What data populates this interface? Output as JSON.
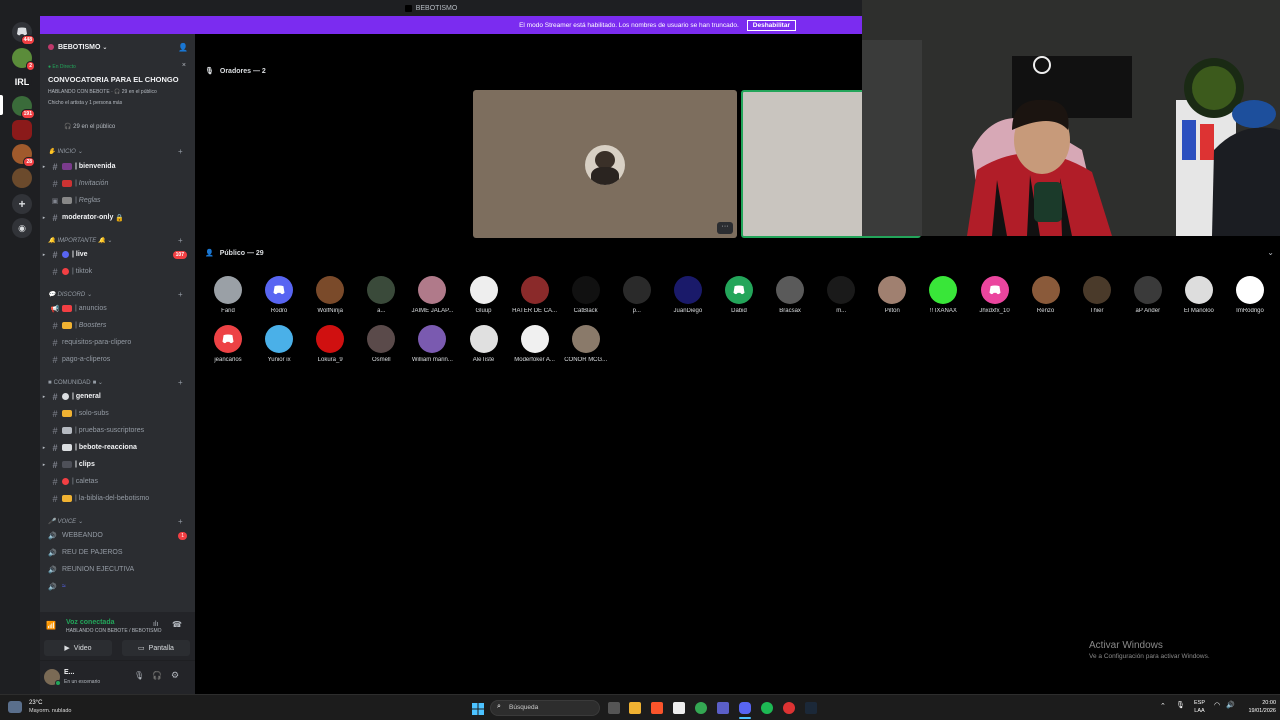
{
  "window": {
    "title": "BEBOTISMO"
  },
  "banner": {
    "message": "El modo Streamer está habilitado. Los nombres de usuario se han truncado.",
    "button": "Deshabilitar",
    "color": "#7b2cf0"
  },
  "rail": {
    "badges": {
      "home": "448",
      "s1": "2",
      "s2": "191",
      "s3": "28"
    },
    "irl_label": "IRL"
  },
  "server": {
    "name": "BEBOTISMO"
  },
  "live": {
    "status": "En Directo",
    "title": "CONVOCATORIA PARA EL CHONGO",
    "sub": "HABLANDO CON BEBOTE · 🎧 29 en el público",
    "sub2": "Chicho el artista y 1 persona más",
    "audience": "29 en el público"
  },
  "categories": {
    "inicio": "INICIO",
    "importante": "IMPORTANTE",
    "discord": "DISCORD",
    "comunidad": "COMUNIDAD",
    "voice": "VOICE"
  },
  "channels": {
    "bienvenida": "| bienvenida",
    "invitacion": "| Invitación",
    "reglas": "| Reglas",
    "moderator": "moderator-only",
    "live": "| live",
    "live_count": "107",
    "tiktok": "| tiktok",
    "anuncios": "| anuncios",
    "boosters": "| Boosters",
    "requisitos": "requisitos-para-clipero",
    "pago": "pago-a-cliperos",
    "general": "| general",
    "solosubs": "| solo-subs",
    "pruebas": "| pruebas-suscriptores",
    "bebote": "| bebote-reacciona",
    "clips": "| clips",
    "caletas": "| caletas",
    "biblia": "| la-biblia-del-bebotismo"
  },
  "voice_channels": {
    "webeando": "WEBEANDO",
    "webeando_count": "1",
    "reu": "REU DE PAJEROS",
    "reunion": "REUNION EJECUTIVA"
  },
  "voice_panel": {
    "status": "Voz conectada",
    "location": "HABLANDO CON BEBOTE / BEBOTISMO",
    "video": "Video",
    "screen": "Pantalla"
  },
  "user_panel": {
    "name": "E...",
    "status": "En un escenario"
  },
  "stage": {
    "speakers_header": "Oradores — 2",
    "audience_header": "Público — 29"
  },
  "audience_row1": [
    "Farid",
    "Rodro",
    "WolfNinja",
    "a...",
    "JAIME JALAP...",
    "Gluup",
    "HATER DE CA...",
    "CatBlack",
    "p...",
    "JuanDiego",
    "Dabid",
    "Bracsax",
    "m...",
    "Pilton",
    "!! IXANAX",
    "Jhxdxfx_10",
    "Renzo",
    "Thier",
    "aP Ander",
    "El Manoloo",
    "ImRodrigo"
  ],
  "audience_row2": [
    "jeancarlos",
    "Yunior ix",
    "Lokura_9",
    "Osmell",
    "William marin...",
    "AleTiste",
    "Moderfoker A...",
    "CONOR MCG..."
  ],
  "watermark": {
    "title": "Activar Windows",
    "sub": "Ve a Configuración para activar Windows."
  },
  "taskbar": {
    "weather_temp": "23°C",
    "weather_desc": "Mayorm. nublado",
    "search": "Búsqueda",
    "lang1": "ESP",
    "lang2": "LAA",
    "time": "20:00",
    "date": "19/01/2026"
  }
}
